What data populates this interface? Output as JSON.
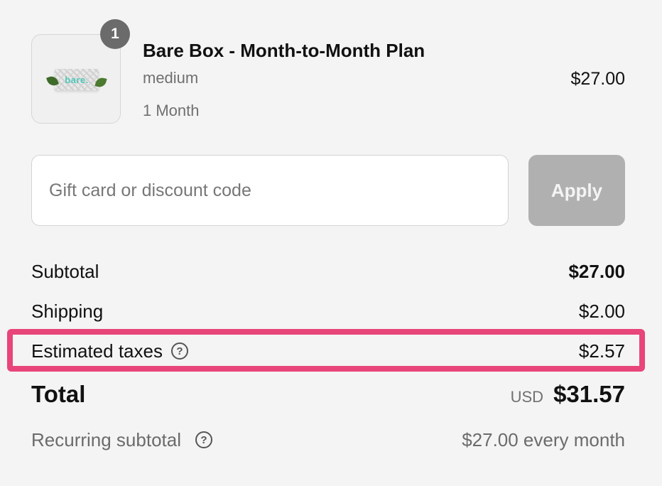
{
  "line_item": {
    "quantity": "1",
    "image_text": "bare.",
    "title": "Bare Box - Month-to-Month Plan",
    "variant": "medium",
    "plan": "1 Month",
    "price": "$27.00"
  },
  "discount": {
    "placeholder": "Gift card or discount code",
    "value": "",
    "apply_label": "Apply"
  },
  "summary": {
    "subtotal_label": "Subtotal",
    "subtotal_value": "$27.00",
    "shipping_label": "Shipping",
    "shipping_value": "$2.00",
    "taxes_label": "Estimated taxes",
    "taxes_value": "$2.57",
    "total_label": "Total",
    "currency": "USD",
    "total_value": "$31.57",
    "recurring_label": "Recurring subtotal",
    "recurring_value": "$27.00 every month"
  },
  "icons": {
    "help": "?"
  },
  "colors": {
    "highlight": "#e8457a",
    "apply_button": "#b0b0b0",
    "badge": "#6b6b6b"
  }
}
